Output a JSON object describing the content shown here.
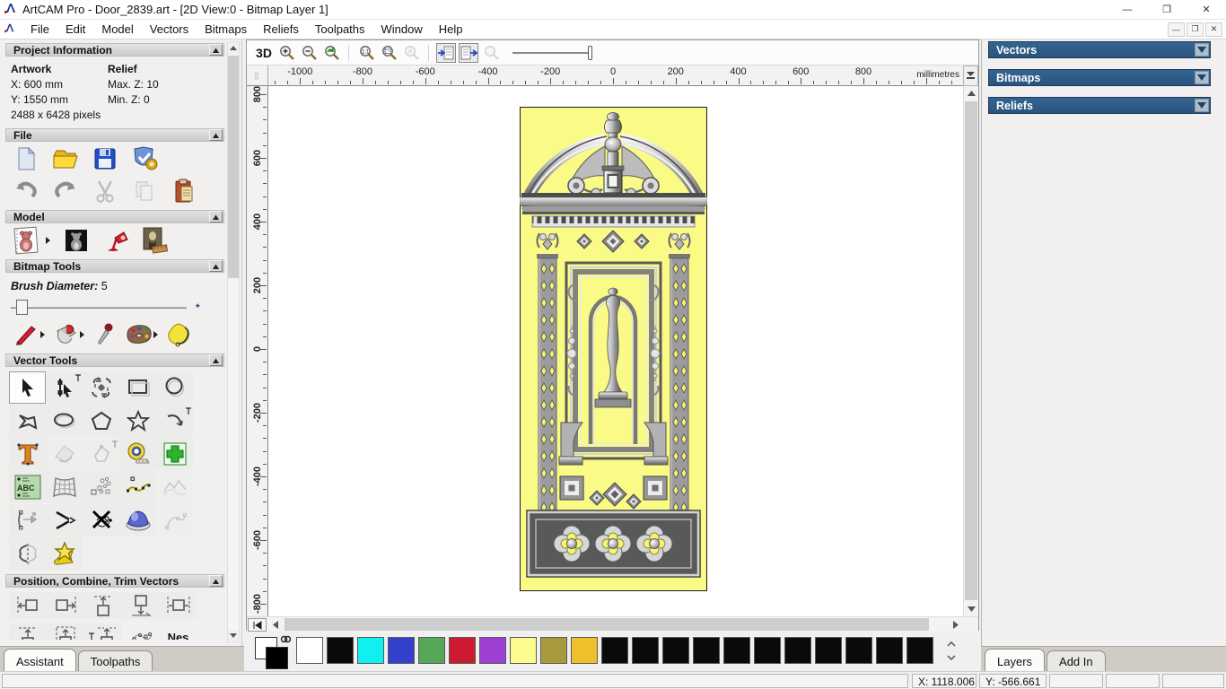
{
  "window": {
    "title": "ArtCAM Pro - Door_2839.art - [2D View:0 - Bitmap Layer 1]",
    "controls": {
      "minimize": "—",
      "restore": "❐",
      "close": "✕"
    }
  },
  "menu": {
    "items": [
      "File",
      "Edit",
      "Model",
      "Vectors",
      "Bitmaps",
      "Reliefs",
      "Toolpaths",
      "Window",
      "Help"
    ],
    "mdi_controls": {
      "minimize": "—",
      "restore": "❐",
      "close": "✕"
    }
  },
  "assistant": {
    "sections": {
      "project_information": {
        "title": "Project Information",
        "artwork_label": "Artwork",
        "artwork_x": "X: 600 mm",
        "artwork_y": "Y: 1550 mm",
        "artwork_pixels": "2488 x 6428 pixels",
        "relief_label": "Relief",
        "relief_max": "Max. Z: 10",
        "relief_min": "Min. Z: 0"
      },
      "file": {
        "title": "File",
        "icons": [
          "new-model",
          "open-model",
          "save-model",
          "relief-clipart",
          "undo",
          "redo",
          "cut",
          "copy",
          "paste"
        ]
      },
      "model": {
        "title": "Model",
        "icons": [
          "set-model-size",
          "greyscale-from-relief",
          "adjust-model-lighting",
          "set-size-from-image"
        ]
      },
      "bitmap_tools": {
        "title": "Bitmap Tools",
        "brush_label": "Brush Diameter:",
        "brush_value": "5",
        "icons": [
          "paint",
          "flood-fill",
          "pick-colour",
          "colour-palette",
          "reduce-colours"
        ]
      },
      "vector_tools": {
        "title": "Vector Tools",
        "abc_label": "ABC",
        "icons": [
          "select-vectors",
          "node-editing",
          "transform-vectors",
          "create-rectangle",
          "create-circle",
          "create-polyline",
          "create-ellipse",
          "create-polygon",
          "create-star",
          "create-arc",
          "create-text",
          "offset-vectors",
          "fit-vectors",
          "measure",
          "vector-doctor",
          "text-on-curve",
          "envelope-distort",
          "block-copy-rotate",
          "fit-arcs-to-polyline",
          "fit-spline",
          "arc-through-points",
          "join-vectors",
          "trim-vectors",
          "interactive-distortion",
          "spline-tools",
          "mirror-vectors",
          "wrap-vectors"
        ]
      },
      "position": {
        "title": "Position, Combine, Trim Vectors",
        "nesting_label": "Nes",
        "icons": [
          "align-left",
          "align-right",
          "align-top",
          "align-bottom",
          "align-centre",
          "combine-a",
          "combine-b",
          "combine-c",
          "block-paste",
          "nesting"
        ]
      }
    },
    "tabs": [
      {
        "label": "Assistant",
        "active": true
      },
      {
        "label": "Toolpaths",
        "active": false
      }
    ]
  },
  "viewport": {
    "toolbar": {
      "to_3d": "3D",
      "buttons": [
        "zoom-in",
        "zoom-out",
        "zoom-previous",
        "zoom-1to1",
        "zoom-box",
        "zoom-object",
        "toggle-bitmap-view",
        "toggle-vector-view",
        "zoom-selected",
        "contrast-slider"
      ]
    },
    "ruler": {
      "top_labels": [
        "-1000",
        "-800",
        "-600",
        "-400",
        "-200",
        "0",
        "200",
        "400",
        "600",
        "800"
      ],
      "left_labels": [
        "800",
        "600",
        "400",
        "200",
        "0",
        "-200",
        "-400",
        "-600",
        "-800"
      ],
      "units": "millimetres"
    }
  },
  "artwork": {
    "background": "#fafa86",
    "description": "ornate door relief"
  },
  "right_panel": {
    "sections": [
      {
        "title": "Vectors"
      },
      {
        "title": "Bitmaps"
      },
      {
        "title": "Reliefs"
      }
    ],
    "tabs": [
      {
        "label": "Layers",
        "active": true
      },
      {
        "label": "Add In",
        "active": false
      }
    ]
  },
  "palette": {
    "primary": "#ffffff",
    "secondary": "#000000",
    "swatches": [
      "#ffffff",
      "#0a0a0a",
      "#10f0f0",
      "#3340cc",
      "#55a656",
      "#cc1a2e",
      "#a03fd4",
      "#fbfb8e",
      "#a89b3d",
      "#efc02c",
      "#0a0a0a",
      "#0a0a0a",
      "#0a0a0a",
      "#0a0a0a",
      "#0a0a0a",
      "#0a0a0a",
      "#0a0a0a",
      "#0a0a0a",
      "#0a0a0a",
      "#0a0a0a",
      "#0a0a0a"
    ]
  },
  "status": {
    "x": "X: 1118.006",
    "y": "Y: -566.661"
  }
}
